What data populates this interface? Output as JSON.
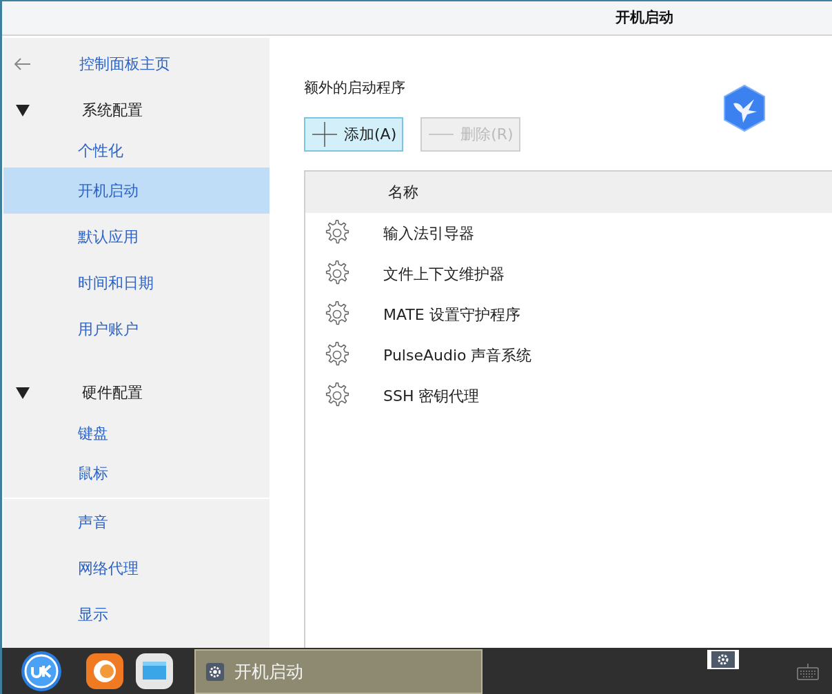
{
  "window": {
    "title": "开机启动"
  },
  "sidebar": {
    "back_label": "控制面板主页",
    "groups": [
      {
        "label": "系统配置",
        "expanded": true,
        "items": [
          {
            "label": "个性化",
            "selected": false
          },
          {
            "label": "开机启动",
            "selected": true
          },
          {
            "label": "默认应用",
            "selected": false
          },
          {
            "label": "时间和日期",
            "selected": false
          },
          {
            "label": "用户账户",
            "selected": false
          }
        ]
      },
      {
        "label": "硬件配置",
        "expanded": true,
        "items": [
          {
            "label": "键盘",
            "selected": false
          },
          {
            "label": "鼠标",
            "selected": false
          }
        ]
      },
      {
        "items": [
          {
            "label": "声音",
            "selected": false
          },
          {
            "label": "网络代理",
            "selected": false
          },
          {
            "label": "显示",
            "selected": false
          }
        ]
      }
    ]
  },
  "section_title": "额外的启动程序",
  "buttons": [
    {
      "kind": "add",
      "label": "添加(A)",
      "disabled": false
    },
    {
      "kind": "remove",
      "label": "删除(R)",
      "disabled": true
    }
  ],
  "table": {
    "columns": [
      "名称"
    ],
    "rows": [
      {
        "name": "输入法引导器"
      },
      {
        "name": "文件上下文维护器"
      },
      {
        "name": "MATE 设置守护程序"
      },
      {
        "name": "PulseAudio 声音系统"
      },
      {
        "name": "SSH 密钥代理"
      }
    ]
  },
  "taskbar": {
    "task": {
      "label": "开机启动"
    }
  }
}
